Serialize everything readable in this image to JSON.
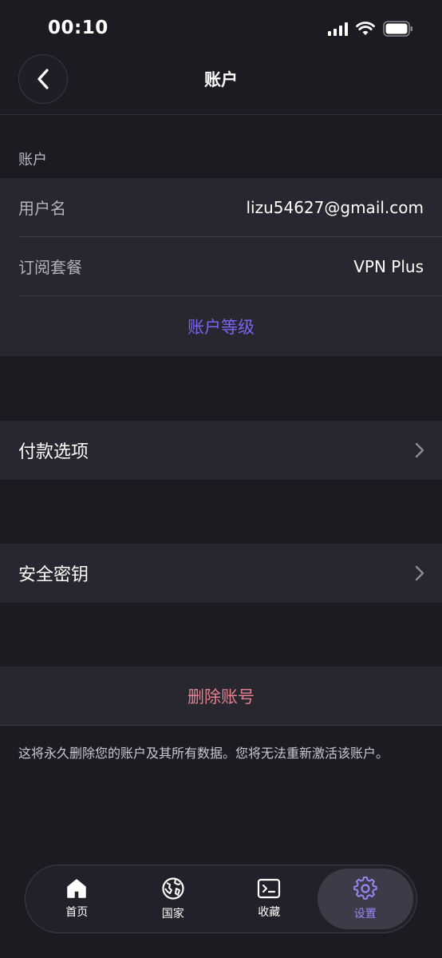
{
  "status_bar": {
    "time": "00:10"
  },
  "header": {
    "title": "账户"
  },
  "account_section": {
    "label": "账户",
    "username_label": "用户名",
    "username_value": "lizu54627@gmail.com",
    "plan_label": "订阅套餐",
    "plan_value": "VPN Plus",
    "level_link": "账户等级"
  },
  "payment": {
    "label": "付款选项"
  },
  "security": {
    "label": "安全密钥"
  },
  "delete": {
    "button": "删除账号",
    "note": "这将永久删除您的账户及其所有数据。您将无法重新激活该账户。"
  },
  "tabs": [
    {
      "label": "首页",
      "icon": "home-icon"
    },
    {
      "label": "国家",
      "icon": "globe-icon"
    },
    {
      "label": "收藏",
      "icon": "terminal-icon"
    },
    {
      "label": "设置",
      "icon": "gear-icon",
      "active": true
    }
  ],
  "colors": {
    "background": "#1c1b22",
    "card": "#28272f",
    "accent": "#7d62f2",
    "danger": "#e2818f"
  }
}
